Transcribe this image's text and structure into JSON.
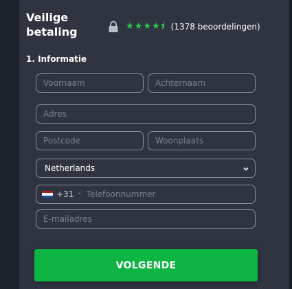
{
  "header": {
    "title": "Veilige betaling",
    "lock_icon": "lock-icon",
    "rating_stars": 4.5,
    "rating_max": 5,
    "reviews_text": "(1378 beoordelingen)",
    "star_color": "#2ecc52"
  },
  "section": {
    "title": "1. Informatie"
  },
  "form": {
    "first_name_placeholder": "Voornaam",
    "last_name_placeholder": "Achternaam",
    "address_placeholder": "Adres",
    "postcode_placeholder": "Postcode",
    "city_placeholder": "Woonplaats",
    "country_value": "Netherlands",
    "phone": {
      "flag": "nl-flag-icon",
      "dial_code": "+31",
      "separator": "•",
      "placeholder": "Telefoonnummer"
    },
    "email_placeholder": "E-mailadres"
  },
  "cta": {
    "label": "VOLGENDE",
    "color": "#0fb543"
  }
}
